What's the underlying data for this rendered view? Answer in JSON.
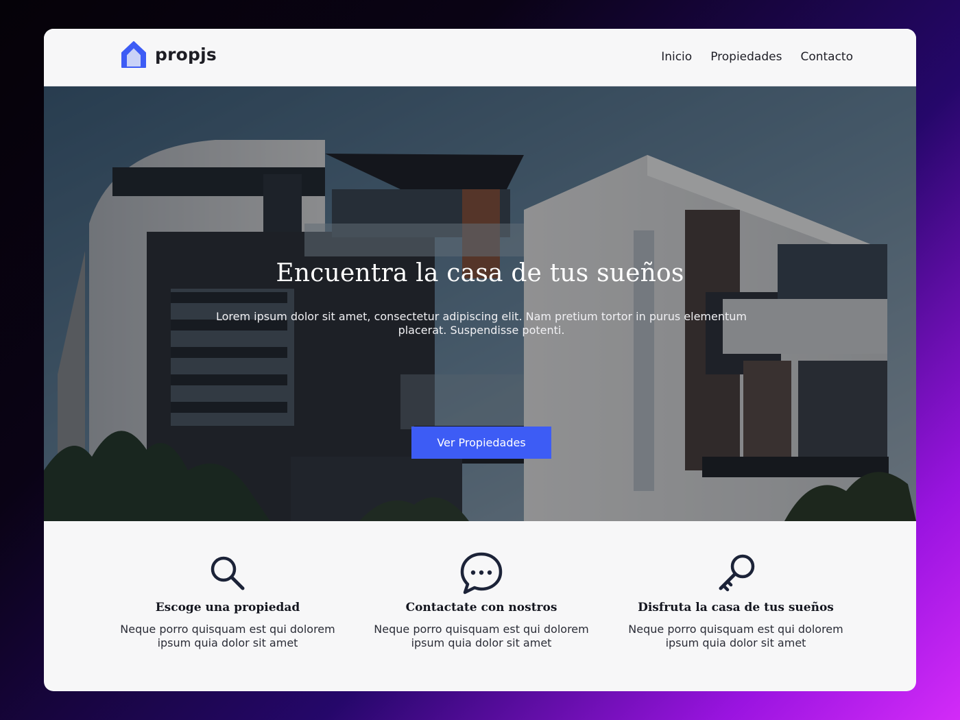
{
  "brand": {
    "name": "propjs",
    "accent_color": "#3d5cf5",
    "icon": "house-icon"
  },
  "nav": {
    "items": [
      {
        "label": "Inicio"
      },
      {
        "label": "Propiedades"
      },
      {
        "label": "Contacto"
      }
    ]
  },
  "hero": {
    "title": "Encuentra la casa de tus sueños",
    "text": "Lorem ipsum dolor sit amet, consectetur adipiscing elit. Nam pretium tortor in purus elementum placerat. Suspendisse potenti.",
    "button_label": "Ver Propiedades"
  },
  "features": [
    {
      "icon": "search-icon",
      "title": "Escoge una propiedad",
      "text": "Neque porro quisquam est qui dolorem ipsum quia dolor sit amet"
    },
    {
      "icon": "chat-bubble-icon",
      "title": "Contactate con nostros",
      "text": "Neque porro quisquam est qui dolorem ipsum quia dolor sit amet"
    },
    {
      "icon": "key-icon",
      "title": "Disfruta la casa de tus sueños",
      "text": "Neque porro quisquam est qui dolorem ipsum quia dolor sit amet"
    }
  ]
}
